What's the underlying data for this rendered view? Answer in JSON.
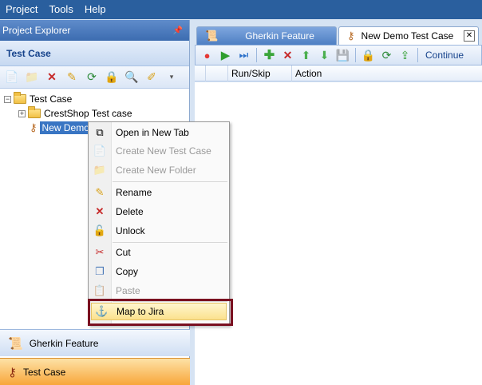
{
  "menubar": {
    "items": [
      "Project",
      "Tools",
      "Help"
    ]
  },
  "left_panel": {
    "title": "Project Explorer",
    "pin_icon": "pin-icon",
    "section_title": "Test Case",
    "tree": {
      "root": "Test Case",
      "children": [
        "CrestShop Test case",
        "New Demo"
      ]
    },
    "bottom_tabs": [
      "Gherkin Feature",
      "Test Case"
    ]
  },
  "right_panel": {
    "tabs": [
      "Gherkin Feature",
      "New Demo Test Case"
    ],
    "close_glyph": "✕",
    "toolbar_continue": "Continue",
    "columns": [
      "",
      "Run/Skip",
      "Action"
    ]
  },
  "context_menu": {
    "items": [
      {
        "label": "Open in New Tab",
        "enabled": true
      },
      {
        "label": "Create New Test Case",
        "enabled": false
      },
      {
        "label": "Create New Folder",
        "enabled": false
      },
      {
        "label": "Rename",
        "enabled": true
      },
      {
        "label": "Delete",
        "enabled": true
      },
      {
        "label": "Unlock",
        "enabled": true
      },
      {
        "label": "Cut",
        "enabled": true
      },
      {
        "label": "Copy",
        "enabled": true
      },
      {
        "label": "Paste",
        "enabled": false
      },
      {
        "label": "Map to Jira",
        "enabled": true
      }
    ]
  },
  "colors": {
    "menubar_bg": "#2a5f9e",
    "selection": "#3975c3",
    "highlight_frame": "#7a1020",
    "active_bottom_tab": "#f8a63a"
  }
}
